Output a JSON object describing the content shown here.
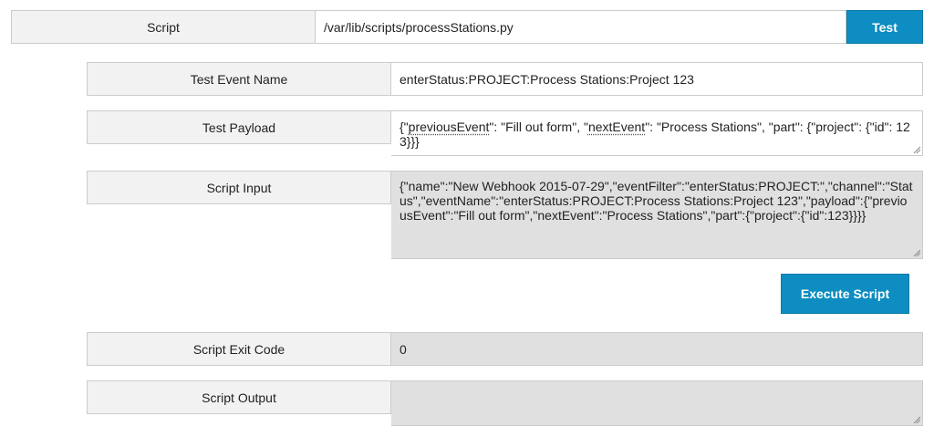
{
  "script": {
    "label": "Script",
    "value": "/var/lib/scripts/processStations.py",
    "test_button": "Test"
  },
  "test_event_name": {
    "label": "Test Event Name",
    "value": "enterStatus:PROJECT:Process Stations:Project 123"
  },
  "test_payload": {
    "label": "Test Payload",
    "parts": [
      "{\"",
      "previousEvent",
      "\": \"Fill out form\", \"",
      "nextEvent",
      "\": \"Process Stations\", \"part\": {\"project\": {\"id\": 123}}}"
    ]
  },
  "script_input": {
    "label": "Script Input",
    "value": "{\"name\":\"New Webhook 2015-07-29\",\"eventFilter\":\"enterStatus:PROJECT:\",\"channel\":\"Status\",\"eventName\":\"enterStatus:PROJECT:Process Stations:Project 123\",\"payload\":{\"previousEvent\":\"Fill out form\",\"nextEvent\":\"Process Stations\",\"part\":{\"project\":{\"id\":123}}}}"
  },
  "execute_button": "Execute Script",
  "exit_code": {
    "label": "Script Exit Code",
    "value": "0"
  },
  "output": {
    "label": "Script Output",
    "value": ""
  },
  "colors": {
    "accent": "#0d8dc1",
    "label_bg": "#f2f2f2",
    "readonly_bg": "#e0e0e0",
    "border": "#cccccc"
  }
}
